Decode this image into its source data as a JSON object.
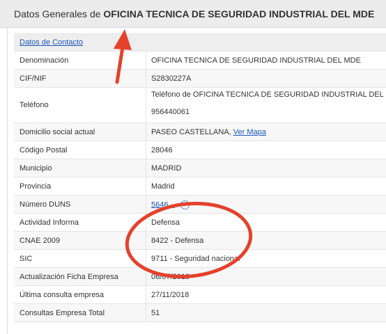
{
  "header": {
    "prefix": "Datos Generales de",
    "company": "OFICINA TECNICA DE SEGURIDAD INDUSTRIAL DEL MDE"
  },
  "contact_link": "Datos de Contacto",
  "rows": {
    "denominacion": {
      "label": "Denominación",
      "value": "OFICINA TECNICA DE SEGURIDAD INDUSTRIAL DEL MDE"
    },
    "cif": {
      "label": "CIF/NIF",
      "value": "S2830227A"
    },
    "telefono": {
      "label": "Teléfono",
      "value_line1": "Teléfono de OFICINA TECNICA DE SEGURIDAD INDUSTRIAL DEL MDE",
      "value_line2": "956440061"
    },
    "domicilio": {
      "label": "Domicilio social actual",
      "value": "PASEO CASTELLANA,",
      "map_link": "Ver Mapa"
    },
    "cp": {
      "label": "Código Postal",
      "value": "28046"
    },
    "municipio": {
      "label": "Municipio",
      "value": "MADRID"
    },
    "provincia": {
      "label": "Provincia",
      "value": "Madrid"
    },
    "duns": {
      "label": "Número DUNS",
      "value": "5646...",
      "help": "?"
    },
    "actividad": {
      "label": "Actividad Informa",
      "value": "Defensa"
    },
    "cnae": {
      "label": "CNAE 2009",
      "value": "8422 - Defensa"
    },
    "sic": {
      "label": "SIC",
      "value": "9711 - Seguridad nacional"
    },
    "actualizacion": {
      "label": "Actualización Ficha Empresa",
      "value": "06/07/2018"
    },
    "ultima": {
      "label": "Última consulta empresa",
      "value": "27/11/2018"
    },
    "consultas": {
      "label": "Consultas Empresa Total",
      "value": "51"
    }
  },
  "colors": {
    "annotation": "#e5412c",
    "link": "#1a56b8"
  }
}
